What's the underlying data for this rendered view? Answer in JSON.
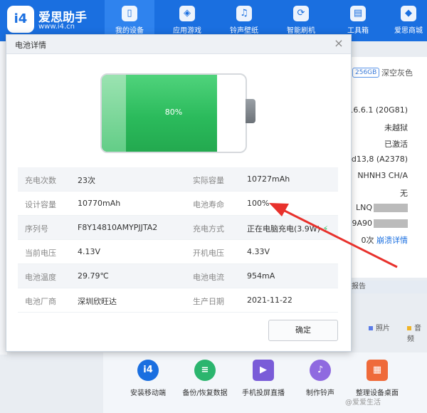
{
  "app": {
    "name": "爱思助手",
    "url": "www.i4.cn",
    "logo": "i4"
  },
  "nav": [
    {
      "label": "我的设备",
      "icon": "phone-icon"
    },
    {
      "label": "应用游戏",
      "icon": "cube-icon"
    },
    {
      "label": "铃声壁纸",
      "icon": "music-icon"
    },
    {
      "label": "智能刷机",
      "icon": "refresh-icon"
    },
    {
      "label": "工具箱",
      "icon": "toolbox-icon"
    },
    {
      "label": "爱思商城",
      "icon": "bag-icon"
    }
  ],
  "device": {
    "capacity": "256GB",
    "color": "深空灰色",
    "lines": [
      "16.6.1 (20G81)",
      "未越狱",
      "已激活",
      "ad13,8 (A2378)",
      "NHNH3 CH/A",
      "无",
      "LNQ",
      "79A90",
      "0次"
    ],
    "crash_link": "崩溃详情",
    "report_tab": "报告"
  },
  "legend": [
    {
      "label": "照片",
      "color": "#5b7ce8"
    },
    {
      "label": "音频",
      "color": "#f0b428"
    }
  ],
  "tools": [
    {
      "label": "安装移动端",
      "icon": "i4",
      "color": "#1a6fe0"
    },
    {
      "label": "备份/恢复数据",
      "icon": "≡",
      "color": "#2bb56e"
    },
    {
      "label": "手机投屏直播",
      "icon": "▶",
      "color": "#7a5cd8"
    },
    {
      "label": "制作铃声",
      "icon": "♪",
      "color": "#8f6ae0"
    },
    {
      "label": "整理设备桌面",
      "icon": "▦",
      "color": "#ef6a3a"
    }
  ],
  "watermark": "@爱爱生活",
  "dialog": {
    "title": "电池详情",
    "close": "×",
    "battery_percent": "80%",
    "battery_level": 0.8,
    "rows": [
      {
        "l1": "充电次数",
        "v1": "23次",
        "l2": "实际容量",
        "v2": "10727mAh"
      },
      {
        "l1": "设计容量",
        "v1": "10770mAh",
        "l2": "电池寿命",
        "v2": "100%"
      },
      {
        "l1": "序列号",
        "v1": "F8Y14810AMYPJJTA2",
        "l2": "充电方式",
        "v2": "正在电脑充电(3.9W)"
      },
      {
        "l1": "当前电压",
        "v1": "4.13V",
        "l2": "开机电压",
        "v2": "4.33V"
      },
      {
        "l1": "电池温度",
        "v1": "29.79℃",
        "l2": "电池电流",
        "v2": "954mA"
      },
      {
        "l1": "电池厂商",
        "v1": "深圳欣旺达",
        "l2": "生产日期",
        "v2": "2021-11-22"
      }
    ],
    "ok_button": "确定"
  }
}
